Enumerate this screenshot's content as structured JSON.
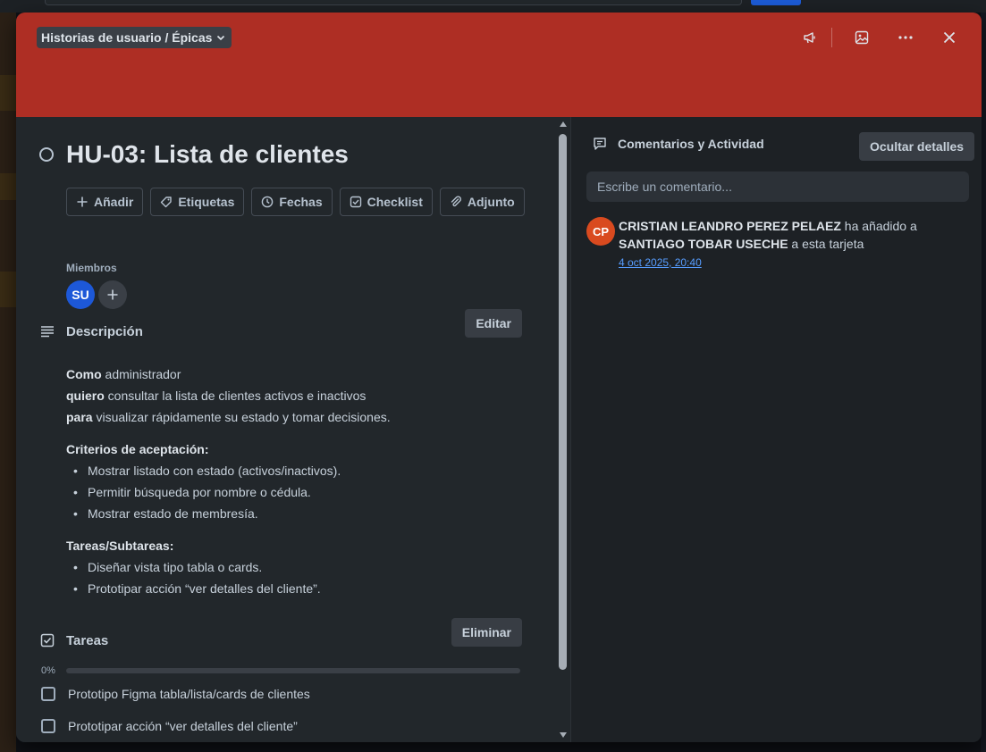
{
  "colors": {
    "cover": "#ae2e24",
    "modal_bg": "#22272b",
    "side_bg": "#1d2125",
    "avatar_su": "#1d58d8",
    "avatar_cp": "#d94a1f",
    "link": "#579dff"
  },
  "header": {
    "list_name": "Historias de usuario / Épicas",
    "icons": [
      "megaphone-icon",
      "image-icon",
      "more-icon",
      "close-icon"
    ]
  },
  "card": {
    "title": "HU-03: Lista de clientes",
    "actions": [
      {
        "label": "Añadir",
        "icon": "plus-icon"
      },
      {
        "label": "Etiquetas",
        "icon": "tag-icon"
      },
      {
        "label": "Fechas",
        "icon": "clock-icon"
      },
      {
        "label": "Checklist",
        "icon": "checklist-icon"
      },
      {
        "label": "Adjunto",
        "icon": "paperclip-icon"
      }
    ],
    "members_label": "Miembros",
    "member_initials": "SU"
  },
  "description": {
    "title": "Descripción",
    "edit_label": "Editar",
    "lines": [
      {
        "bold": "Como",
        "text": " administrador"
      },
      {
        "bold": "quiero",
        "text": " consultar la lista de clientes activos e inactivos"
      },
      {
        "bold": "para",
        "text": " visualizar rápidamente su estado y tomar decisiones."
      }
    ],
    "criteria_title": "Criterios de aceptación:",
    "criteria": [
      "Mostrar listado con estado (activos/inactivos).",
      "Permitir búsqueda por nombre o cédula.",
      "Mostrar estado de membresía."
    ],
    "tasks_title": "Tareas/Subtareas:",
    "tasks": [
      "Diseñar vista tipo tabla o cards.",
      "Prototipar acción “ver detalles del cliente”."
    ]
  },
  "checklist": {
    "title": "Tareas",
    "delete_label": "Eliminar",
    "progress_text": "0%",
    "progress": 0,
    "items": [
      {
        "text": "Prototipo Figma tabla/lista/cards de clientes",
        "checked": false
      },
      {
        "text": "Prototipar acción “ver detalles del cliente”",
        "checked": false
      }
    ]
  },
  "activity": {
    "title": "Comentarios y Actividad",
    "hide_details_label": "Ocultar detalles",
    "comment_placeholder": "Escribe un comentario...",
    "entries": [
      {
        "initials": "CP",
        "actor": "CRISTIAN LEANDRO PEREZ PELAEZ",
        "verb": " ha añadido a ",
        "target": "SANTIAGO TOBAR USECHE",
        "suffix": " a esta tarjeta",
        "time": "4 oct 2025, 20:40"
      }
    ]
  }
}
